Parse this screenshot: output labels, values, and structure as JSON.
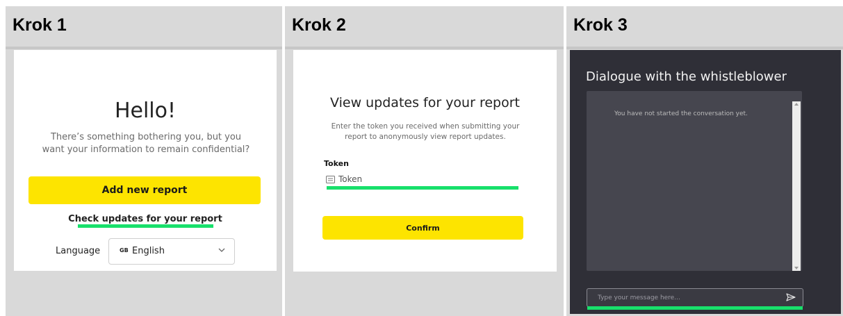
{
  "steps": [
    {
      "label": "Krok 1"
    },
    {
      "label": "Krok 2"
    },
    {
      "label": "Krok 3"
    }
  ],
  "step1": {
    "title": "Hello!",
    "subtitle": "There’s something bothering you, but you want your information to remain confidential?",
    "add_report_label": "Add new report",
    "check_updates_label": "Check updates for your report",
    "language_label": "Language",
    "language_flag": "GB",
    "language_value": "English"
  },
  "step2": {
    "title": "View updates for your report",
    "subtitle": "Enter the token you received when submitting your report to anonymously view report updates.",
    "token_label": "Token",
    "token_placeholder": "Token",
    "confirm_label": "Confirm"
  },
  "step3": {
    "title": "Dialogue with the whistleblower",
    "empty_message": "You have not started the conversation yet.",
    "message_placeholder": "Type your message here..."
  },
  "colors": {
    "accent_yellow": "#fde400",
    "highlight_green": "#18e06b",
    "dark_panel": "#2f2f37"
  }
}
